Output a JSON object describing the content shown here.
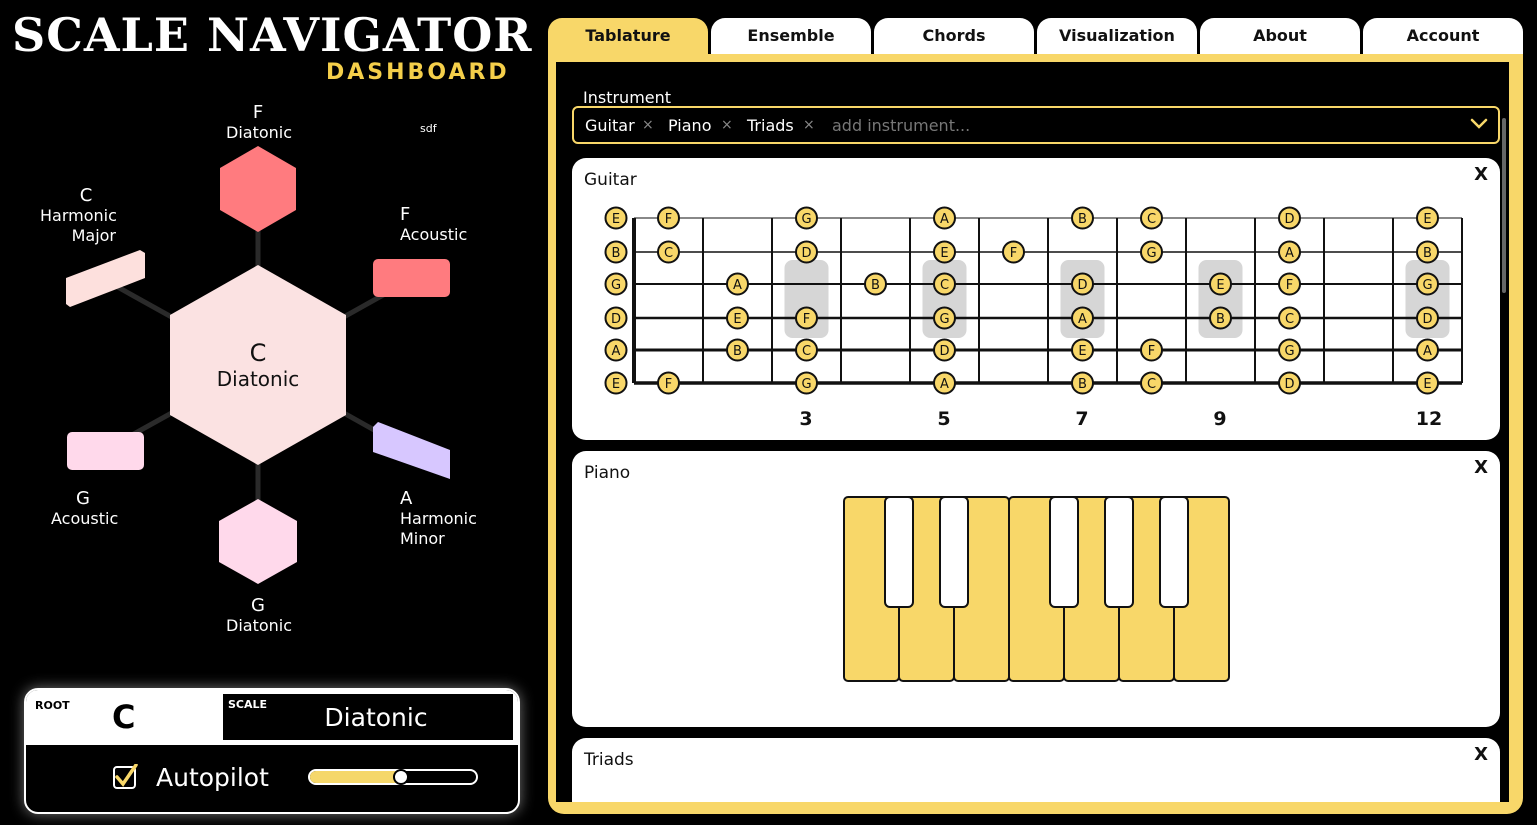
{
  "header": {
    "title": "SCALE NAVIGATOR",
    "subtitle": "DASHBOARD"
  },
  "graph": {
    "debug_text": "sdf",
    "center": {
      "key": "C",
      "scale": "Diatonic",
      "color": "#fbe2e2"
    },
    "nodes": [
      {
        "id": "top",
        "key": "F",
        "scale_lines": [
          "Diatonic"
        ],
        "color": "#ff7b7f"
      },
      {
        "id": "top-right",
        "key": "F",
        "scale_lines": [
          "Acoustic"
        ],
        "color": "#ff7b7f"
      },
      {
        "id": "bottom-right",
        "key": "A",
        "scale_lines": [
          "Harmonic",
          "Minor"
        ],
        "color": "#d7c7ff"
      },
      {
        "id": "bottom",
        "key": "G",
        "scale_lines": [
          "Diatonic"
        ],
        "color": "#ffd9eb"
      },
      {
        "id": "bottom-left",
        "key": "G",
        "scale_lines": [
          "Acoustic"
        ],
        "color": "#ffd9eb"
      },
      {
        "id": "top-left",
        "key": "C",
        "scale_lines": [
          "Harmonic",
          "Major"
        ],
        "color": "#fde0dd"
      }
    ]
  },
  "control": {
    "root_caption": "ROOT",
    "root_value": "C",
    "scale_caption": "SCALE",
    "scale_value": "Diatonic",
    "autopilot_label": "Autopilot",
    "autopilot_checked": true,
    "autopilot_speed": 0.55
  },
  "tabs": [
    {
      "label": "Tablature",
      "active": true
    },
    {
      "label": "Ensemble",
      "active": false
    },
    {
      "label": "Chords",
      "active": false
    },
    {
      "label": "Visualization",
      "active": false
    },
    {
      "label": "About",
      "active": false
    },
    {
      "label": "Account",
      "active": false
    }
  ],
  "instrument": {
    "label": "Instrument",
    "selected": [
      "Guitar",
      "Piano",
      "Triads"
    ],
    "placeholder": "add instrument..."
  },
  "cards": {
    "guitar": {
      "title": "Guitar",
      "close": "X",
      "fret_markers": [
        "3",
        "5",
        "7",
        "9",
        "12"
      ],
      "strings_top_to_bottom": [
        [
          [
            0,
            "E"
          ],
          [
            1,
            "F"
          ],
          [
            3,
            "G"
          ],
          [
            5,
            "A"
          ],
          [
            7,
            "B"
          ],
          [
            8,
            "C"
          ],
          [
            10,
            "D"
          ],
          [
            12,
            "E"
          ]
        ],
        [
          [
            0,
            "B"
          ],
          [
            1,
            "C"
          ],
          [
            3,
            "D"
          ],
          [
            5,
            "E"
          ],
          [
            6,
            "F"
          ],
          [
            8,
            "G"
          ],
          [
            10,
            "A"
          ],
          [
            12,
            "B"
          ]
        ],
        [
          [
            0,
            "G"
          ],
          [
            2,
            "A"
          ],
          [
            4,
            "B"
          ],
          [
            5,
            "C"
          ],
          [
            7,
            "D"
          ],
          [
            9,
            "E"
          ],
          [
            10,
            "F"
          ],
          [
            12,
            "G"
          ]
        ],
        [
          [
            0,
            "D"
          ],
          [
            2,
            "E"
          ],
          [
            3,
            "F"
          ],
          [
            5,
            "G"
          ],
          [
            7,
            "A"
          ],
          [
            9,
            "B"
          ],
          [
            10,
            "C"
          ],
          [
            12,
            "D"
          ]
        ],
        [
          [
            0,
            "A"
          ],
          [
            2,
            "B"
          ],
          [
            3,
            "C"
          ],
          [
            5,
            "D"
          ],
          [
            7,
            "E"
          ],
          [
            8,
            "F"
          ],
          [
            10,
            "G"
          ],
          [
            12,
            "A"
          ]
        ],
        [
          [
            0,
            "E"
          ],
          [
            1,
            "F"
          ],
          [
            3,
            "G"
          ],
          [
            5,
            "A"
          ],
          [
            7,
            "B"
          ],
          [
            8,
            "C"
          ],
          [
            10,
            "D"
          ],
          [
            12,
            "E"
          ]
        ]
      ],
      "highlight_frets": [
        3,
        5,
        7,
        9,
        12
      ]
    },
    "piano": {
      "title": "Piano",
      "close": "X",
      "white_keys": 7,
      "black_keys": 5
    },
    "triads": {
      "title": "Triads",
      "close": "X"
    }
  },
  "colors": {
    "accent": "#f8d769",
    "note_fill": "#f8d769"
  }
}
